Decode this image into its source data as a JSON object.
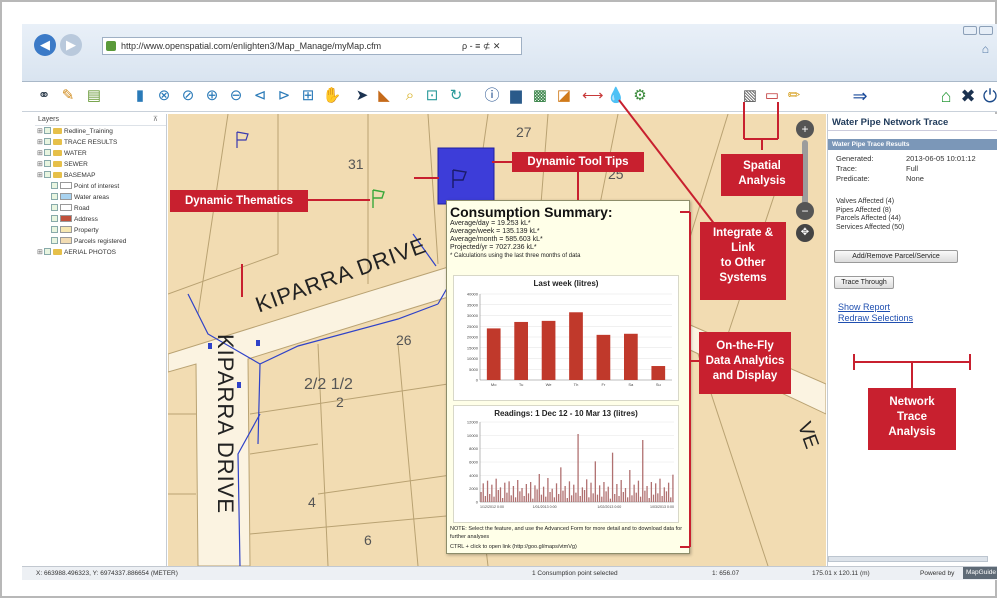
{
  "browser": {
    "url": "http://www.openspatial.com/enlighten3/Map_Manage/myMap.cfm",
    "search_glyphs": "ρ - ≡ ⊄ ✕",
    "back_glyph": "◀",
    "forward_glyph": "▶"
  },
  "layers": {
    "header": "Layers",
    "items": [
      {
        "label": "Redline_Training",
        "indent": 0,
        "kind": "group"
      },
      {
        "label": "TRACE RESULTS",
        "indent": 0,
        "kind": "group"
      },
      {
        "label": "WATER",
        "indent": 0,
        "kind": "group"
      },
      {
        "label": "SEWER",
        "indent": 0,
        "kind": "group"
      },
      {
        "label": "BASEMAP",
        "indent": 0,
        "kind": "group"
      },
      {
        "label": "Point of interest",
        "indent": 1,
        "kind": "point"
      },
      {
        "label": "Water areas",
        "indent": 1,
        "kind": "water"
      },
      {
        "label": "Road",
        "indent": 1,
        "kind": "road"
      },
      {
        "label": "Address",
        "indent": 1,
        "kind": "address"
      },
      {
        "label": "Property",
        "indent": 1,
        "kind": "property"
      },
      {
        "label": "Parcels registered",
        "indent": 1,
        "kind": "parcel"
      },
      {
        "label": "AERIAL PHOTOS",
        "indent": 0,
        "kind": "group"
      }
    ]
  },
  "map": {
    "parcel_numbers": [
      "27",
      "31",
      "26",
      "2/2 1/2",
      "2",
      "4",
      "6"
    ],
    "streets": [
      "KIPARRA DRIVE",
      "KIPARRA DRIVE"
    ],
    "partial_labels": [
      "25",
      "VE"
    ]
  },
  "popup": {
    "title": "Consumption Summary:",
    "lines": [
      "Average/day = 19.253 kL*",
      "Average/week = 135.139 kL*",
      "Average/month = 585.603 kL*",
      "Projected/yr = 7027.236 kL*",
      "* Calculations using the last three months of data"
    ],
    "chart1_title": "Last week (litres)",
    "chart2_title": "Readings: 1 Dec 12 - 10 Mar 13 (litres)",
    "note": "NOTE: Select the feature, and use the Advanced Form for more detail and to download data for further analyses",
    "ctrl_hint": "CTRL + click to open link (http://goo.gl/maps/vtmVg)"
  },
  "chart_data": [
    {
      "type": "bar",
      "title": "Last week (litres)",
      "categories": [
        "Mo",
        "Tu",
        "We",
        "Th",
        "Fr",
        "Sa",
        "Su"
      ],
      "values": [
        24000,
        27000,
        27500,
        31500,
        21000,
        21500,
        6500
      ],
      "ylim": [
        0,
        40000
      ],
      "yticks": [
        "0",
        "5000",
        "10000",
        "15000",
        "20000",
        "25000",
        "30000",
        "35000",
        "40000"
      ],
      "color": "#c0392b"
    },
    {
      "type": "bar",
      "title": "Readings: 1 Dec 12 - 10 Mar 13 (litres)",
      "ylim": [
        0,
        12000
      ],
      "yticks": [
        "0",
        "2000",
        "4000",
        "6000",
        "8000",
        "10000",
        "12000"
      ],
      "xticks": [
        "1/12/2012 0:00",
        "1/01/2013 0:00",
        "1/02/2013 0:00",
        "1/03/2013 0:00"
      ],
      "values": [
        1500,
        2800,
        900,
        3200,
        1200,
        2600,
        800,
        3500,
        1800,
        2200,
        600,
        2900,
        1400,
        3100,
        1000,
        2400,
        700,
        3300,
        1600,
        2100,
        900,
        2700,
        1300,
        3000,
        500,
        2500,
        1900,
        4200,
        1100,
        2300,
        800,
        3600,
        1500,
        2000,
        700,
        2800,
        1200,
        5200,
        1700,
        2400,
        600,
        3100,
        1000,
        2600,
        1400,
        10200,
        900,
        2200,
        1800,
        3400,
        700,
        2900,
        1300,
        6100,
        1100,
        2500,
        800,
        3000,
        1600,
        2300,
        500,
        7400,
        1200,
        2700,
        900,
        3300,
        1500,
        2100,
        700,
        4800,
        1000,
        2600,
        1400,
        3200,
        800,
        9300,
        1700,
        2400,
        600,
        3000,
        1100,
        2800,
        1300,
        3500,
        900,
        2200,
        1600,
        2900,
        700,
        4100
      ],
      "color": "#b07070"
    }
  ],
  "trace": {
    "title": "Water Pipe Network Trace",
    "subheader": "Water Pipe Trace Results",
    "rows": [
      {
        "k": "Generated:",
        "v": "2013-06-05 10:01:12"
      },
      {
        "k": "Trace:",
        "v": "Full"
      },
      {
        "k": "Predicate:",
        "v": "None"
      }
    ],
    "affected": [
      "Valves Affected (4)",
      "Pipes Affected (8)",
      "Parcels Affected (44)",
      "Services Affected (50)"
    ],
    "btn_add": "Add/Remove Parcel/Service",
    "btn_trace": "Trace Through",
    "link_report": "Show Report",
    "link_redraw": "Redraw Selections"
  },
  "status": {
    "coords": "X: 663988.496323, Y: 6974337.886654 (METER)",
    "selection": "1 Consumption point selected",
    "scale": "1: 656.07",
    "extent": "175.01 x 120.11 (m)",
    "powered": "Powered by",
    "brand": "MapGuide"
  },
  "callouts": {
    "dyn_thematics": "Dynamic Thematics",
    "dyn_tooltips": "Dynamic Tool Tips",
    "spatial_analysis": [
      "Spatial",
      "Analysis"
    ],
    "integrate": [
      "Integrate &",
      "Link",
      "to Other",
      "Systems"
    ],
    "onthefly": [
      "On-the-Fly",
      "Data Analytics",
      "and Display"
    ],
    "network": [
      "Network",
      "Trace",
      "Analysis"
    ]
  },
  "colors": {
    "callout": "#c8202f",
    "map_bg": "#f2dcb2",
    "parcel_line": "#b9a272",
    "pipe": "#2f42c8",
    "highlight": "#3d3dd9",
    "link": "#1f4fb0"
  },
  "icons": [
    "back-icon",
    "forward-icon",
    "binoculars-icon",
    "edit-icon",
    "zoom-in-icon",
    "zoom-out-icon",
    "pan-icon",
    "select-icon",
    "info-icon",
    "measure-icon",
    "tap-icon",
    "buffer-icon",
    "arrow-right-icon",
    "home-icon",
    "tools-icon",
    "power-icon"
  ]
}
